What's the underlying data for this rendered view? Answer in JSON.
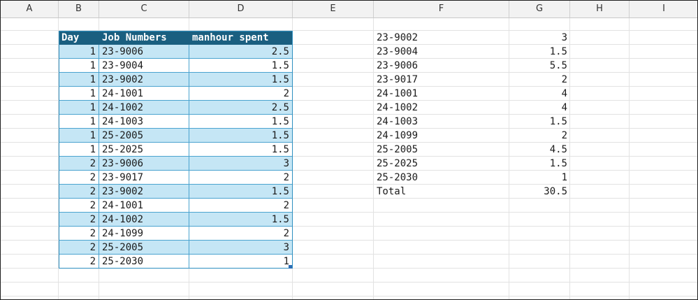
{
  "columns": [
    "A",
    "B",
    "C",
    "D",
    "E",
    "F",
    "G",
    "H",
    "I"
  ],
  "table": {
    "headers": [
      "Day",
      "Job Numbers",
      "manhour spent"
    ],
    "rows": [
      [
        "1",
        "23-9006",
        "2.5"
      ],
      [
        "1",
        "23-9004",
        "1.5"
      ],
      [
        "1",
        "23-9002",
        "1.5"
      ],
      [
        "1",
        "24-1001",
        "2"
      ],
      [
        "1",
        "24-1002",
        "2.5"
      ],
      [
        "1",
        "24-1003",
        "1.5"
      ],
      [
        "1",
        "25-2005",
        "1.5"
      ],
      [
        "1",
        "25-2025",
        "1.5"
      ],
      [
        "2",
        "23-9006",
        "3"
      ],
      [
        "2",
        "23-9017",
        "2"
      ],
      [
        "2",
        "23-9002",
        "1.5"
      ],
      [
        "2",
        "24-1001",
        "2"
      ],
      [
        "2",
        "24-1002",
        "1.5"
      ],
      [
        "2",
        "24-1099",
        "2"
      ],
      [
        "2",
        "25-2005",
        "3"
      ],
      [
        "2",
        "25-2030",
        "1"
      ]
    ]
  },
  "summary": {
    "rows": [
      [
        "23-9002",
        "3"
      ],
      [
        "23-9004",
        "1.5"
      ],
      [
        "23-9006",
        "5.5"
      ],
      [
        "23-9017",
        "2"
      ],
      [
        "24-1001",
        "4"
      ],
      [
        "24-1002",
        "4"
      ],
      [
        "24-1003",
        "1.5"
      ],
      [
        "24-1099",
        "2"
      ],
      [
        "25-2005",
        "4.5"
      ],
      [
        "25-2025",
        "1.5"
      ],
      [
        "25-2030",
        "1"
      ],
      [
        "Total",
        "30.5"
      ]
    ]
  },
  "colors": {
    "header_bg": "#1a5f80",
    "band_bg": "#c5e6f5",
    "table_border": "#2e8fc0"
  }
}
